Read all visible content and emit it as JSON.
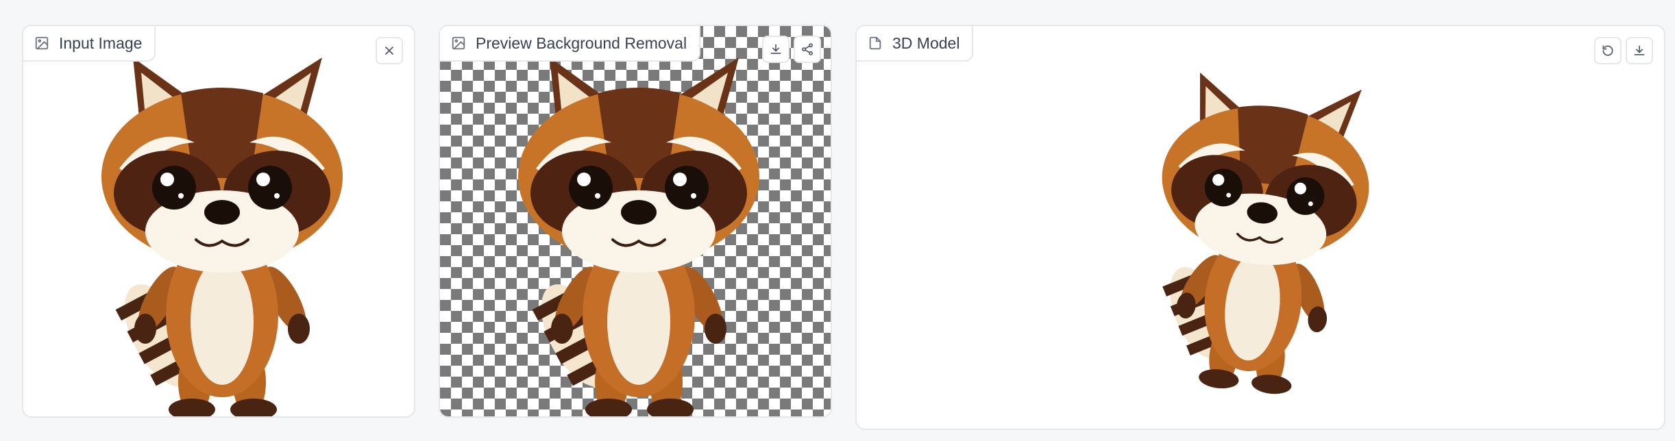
{
  "panels": {
    "input": {
      "label": "Input Image",
      "icon": "image-icon",
      "actions": [
        "close-icon"
      ]
    },
    "preview": {
      "label": "Preview Background Removal",
      "icon": "image-icon",
      "actions": [
        "download-icon",
        "share-icon"
      ]
    },
    "model": {
      "label": "3D Model",
      "icon": "file-icon",
      "actions": [
        "undo-icon",
        "download-icon"
      ]
    }
  },
  "colors": {
    "page_bg": "#f6f7f9",
    "panel_border": "#e5e7eb",
    "label_text": "#374151",
    "icon": "#6b7280",
    "checker_dark": "#7a7a7a",
    "fur_dark": "#5a2a14",
    "fur_orange": "#c06a26",
    "fur_cream": "#f5ead8"
  }
}
